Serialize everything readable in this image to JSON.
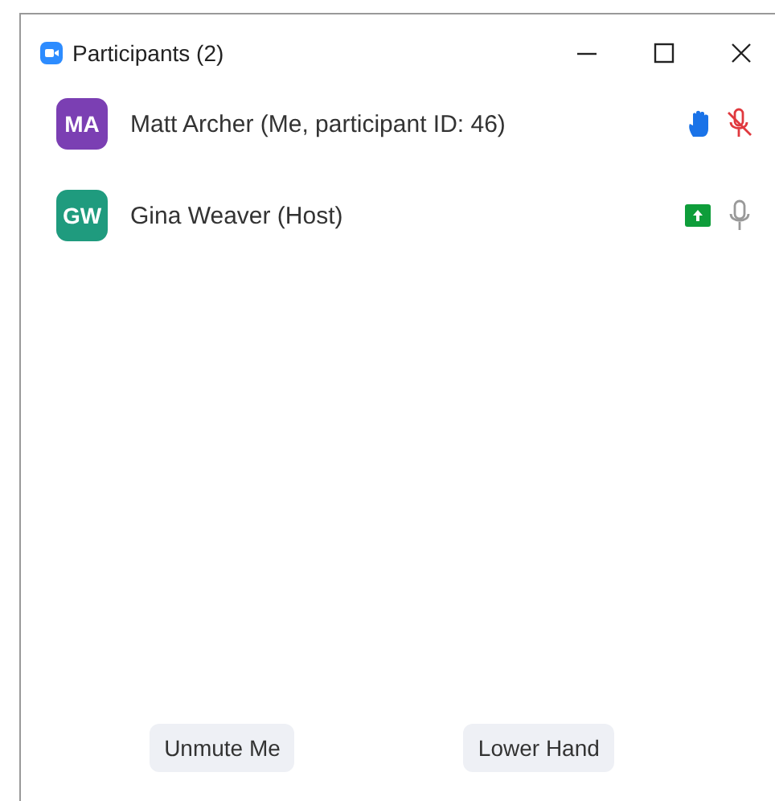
{
  "window": {
    "title": "Participants (2)"
  },
  "participants": [
    {
      "initials": "MA",
      "name": "Matt Archer (Me, participant ID: 46)",
      "color": "#7b3fb3",
      "hand_raised": true,
      "sharing": false,
      "muted": true
    },
    {
      "initials": "GW",
      "name": "Gina Weaver (Host)",
      "color": "#1f9b7e",
      "hand_raised": false,
      "sharing": true,
      "muted": false
    }
  ],
  "buttons": [
    "Unmute Me",
    "Lower Hand"
  ]
}
